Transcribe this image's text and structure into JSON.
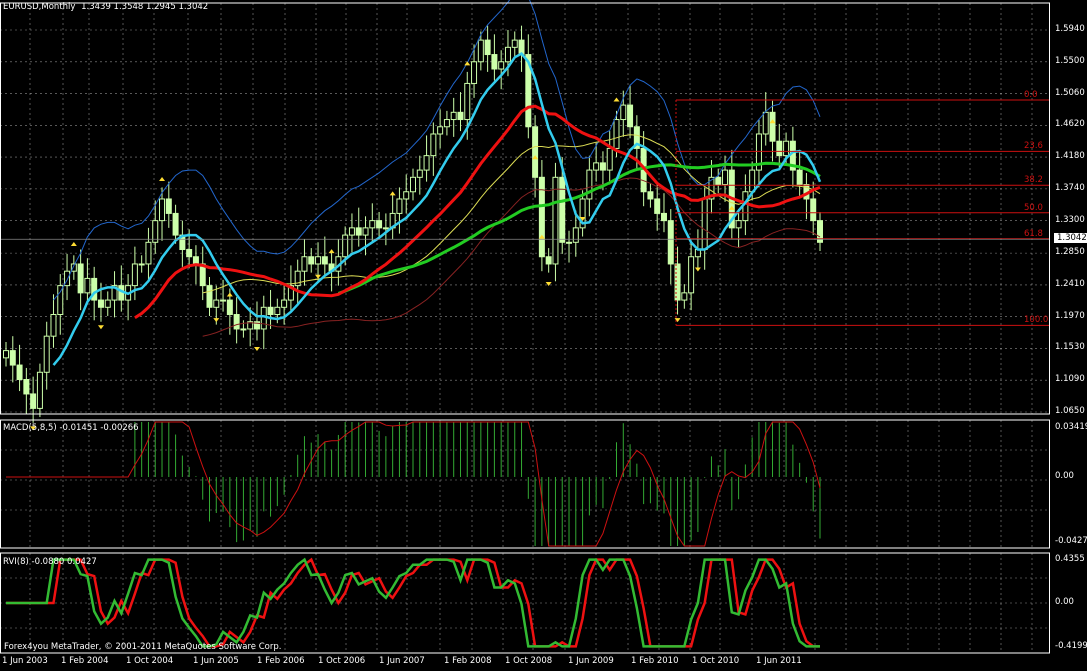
{
  "main": {
    "symbol": "EURUSD,Monthly",
    "ohlc": "1.3439 1.3548 1.2945 1.3042",
    "price_ticks": [
      "1.5940",
      "1.5500",
      "1.5060",
      "1.4620",
      "1.4180",
      "1.3740",
      "1.3300",
      "1.2850",
      "1.2410",
      "1.1970",
      "1.1530",
      "1.1090",
      "1.0650"
    ],
    "current_price": "1.3042",
    "fib_levels": [
      {
        "label": "0.0",
        "price": 1.497
      },
      {
        "label": "23.6",
        "price": 1.426
      },
      {
        "label": "38.2",
        "price": 1.379
      },
      {
        "label": "50.0",
        "price": 1.341
      },
      {
        "label": "61.8",
        "price": 1.305
      },
      {
        "label": "100.0",
        "price": 1.185
      }
    ]
  },
  "macd": {
    "title": "MACD(5,8,5) -0.01451 -0.00266",
    "ticks": [
      "0.03419",
      "0.00",
      "-0.0427"
    ]
  },
  "rvi": {
    "title": "RVI(8) -0.0880 0.0427",
    "ticks": [
      "0.4355",
      "0.00",
      "-0.4199"
    ]
  },
  "time_axis": [
    "1 Jun 2003",
    "1 Feb 2004",
    "1 Oct 2004",
    "1 Jun 2005",
    "1 Feb 2006",
    "1 Oct 2006",
    "1 Jun 2007",
    "1 Feb 2008",
    "1 Oct 2008",
    "1 Jun 2009",
    "1 Feb 2010",
    "1 Oct 2010",
    "1 Jun 2011"
  ],
  "copyright": "Forex4you MetaTrader, © 2001-2011 MetaQuotes Software Corp.",
  "colors": {
    "bull_candle": "#ccffaa",
    "fib": "#cc1111",
    "ma_fast": "#33ccee",
    "ma_mid": "#ee1111",
    "ma_slow": "#22cc22",
    "ma_long": "#dddd55",
    "envelope": "#2266cc",
    "fractal": "#ffdd33",
    "macd_hist": "#33aa33",
    "macd_signal": "#cc1111",
    "rvi_main": "#33bb33",
    "rvi_signal": "#ee1111",
    "grid": "#ffffff"
  }
}
